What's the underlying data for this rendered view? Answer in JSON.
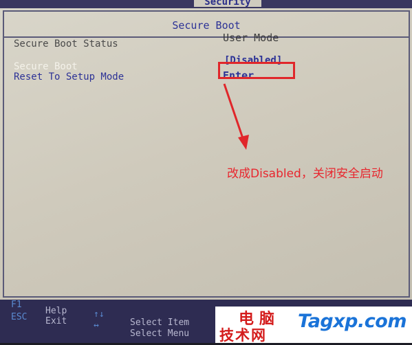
{
  "top_tab": {
    "label": "Security"
  },
  "section": {
    "title": "Secure Boot"
  },
  "settings": {
    "status_label": "Secure Boot Status",
    "status_value": "User Mode",
    "secure_boot_label": "Secure Boot",
    "secure_boot_value": "[Disabled]",
    "reset_label": "Reset To Setup Mode",
    "reset_value": "Enter"
  },
  "annotation": {
    "text": "改成Disabled，关闭安全启动",
    "color": "#e8262e"
  },
  "footer": {
    "keys": [
      {
        "key": "F1",
        "action": "Help"
      },
      {
        "key": "ESC",
        "action": "Exit"
      },
      {
        "key": "↑↓",
        "action": "Select Item"
      },
      {
        "key": "↔",
        "action": "Select Menu"
      }
    ]
  },
  "watermark": {
    "line1": "电脑",
    "line2": "技术网",
    "brand": "Tagxp.com"
  },
  "colors": {
    "bios_blue": "#2c3296",
    "highlight": "#f4f2ea",
    "annotation_red": "#e0262a",
    "footer_bg": "#2e2c52"
  }
}
